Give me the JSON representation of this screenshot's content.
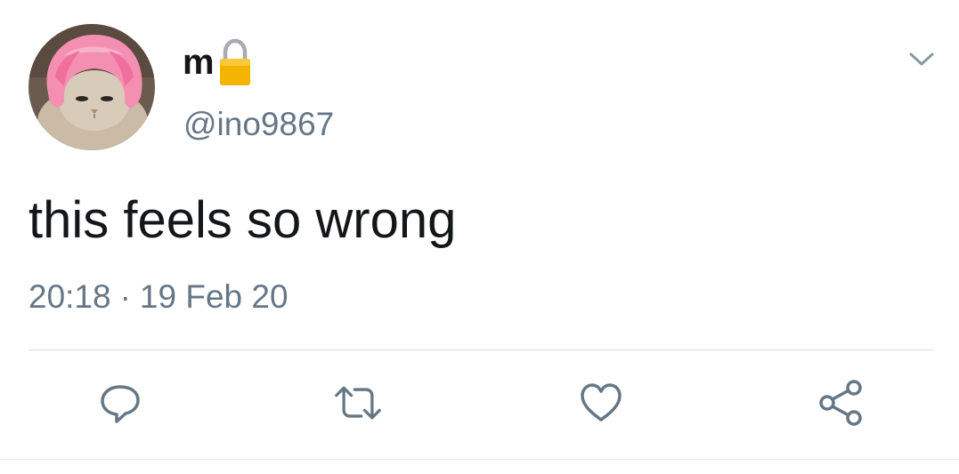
{
  "tweet": {
    "display_name": "m",
    "handle": "@ino9867",
    "text": "this feels so wrong",
    "time": "20:18",
    "separator": "·",
    "date": "19 Feb 20"
  },
  "icons": {
    "lock": "lock-icon",
    "menu": "chevron-down-icon",
    "reply": "reply-icon",
    "retweet": "retweet-icon",
    "like": "heart-icon",
    "share": "share-icon"
  },
  "colors": {
    "text_primary": "#14171a",
    "text_secondary": "#657786",
    "icon": "#657786",
    "lock_gold": "#f4b400",
    "divider": "#e1e8ed",
    "avatar_wig": "#f48fb1"
  }
}
